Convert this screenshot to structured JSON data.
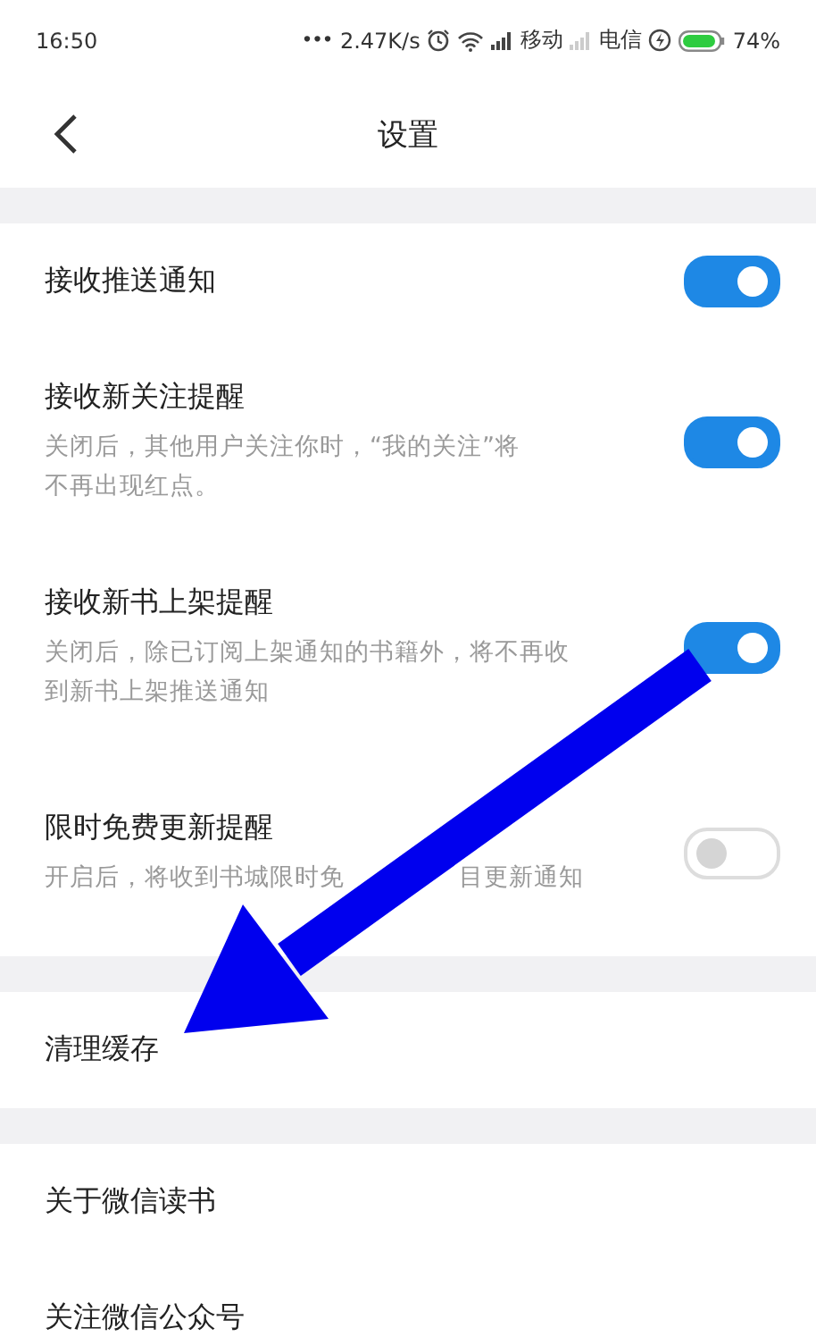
{
  "status_bar": {
    "time": "16:50",
    "dots": "•••",
    "speed": "2.47K/s",
    "carrier_1": "移动",
    "carrier_2": "电信",
    "battery": "74%"
  },
  "nav": {
    "title": "设置"
  },
  "sections": [
    {
      "rows": [
        {
          "kind": "toggle",
          "title": "接收推送通知",
          "on": true
        },
        {
          "kind": "toggle",
          "title": "接收新关注提醒",
          "description_lines": [
            "关闭后，其他用户关注你时，“我的关注”将",
            "不再出现红点。"
          ],
          "on": true
        },
        {
          "kind": "toggle",
          "title": "接收新书上架提醒",
          "description_lines": [
            "关闭后，除已订阅上架通知的书籍外，将不再收",
            "到新书上架推送通知"
          ],
          "on": true
        },
        {
          "kind": "toggle",
          "title": "限时免费更新提醒",
          "description_parts": [
            "开启后，将收到书城限时免",
            "目更新通知"
          ],
          "on": false
        }
      ]
    },
    {
      "rows": [
        {
          "kind": "link",
          "title": "清理缓存"
        }
      ]
    },
    {
      "rows": [
        {
          "kind": "link",
          "title": "关于微信读书"
        },
        {
          "kind": "link",
          "title": "关注微信公众号"
        }
      ]
    }
  ],
  "annotation": {
    "kind": "arrow"
  }
}
